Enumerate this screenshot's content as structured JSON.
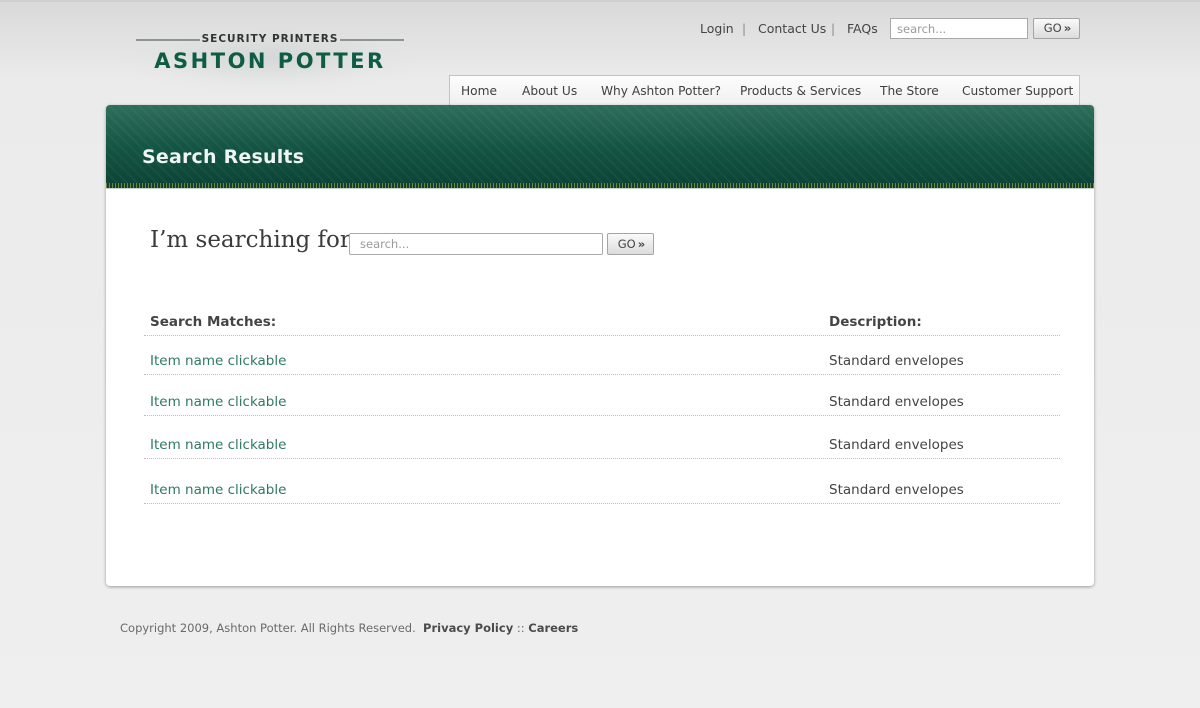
{
  "header": {
    "logo": {
      "tagline": "SECURITY PRINTERS",
      "name": "ASHTON POTTER"
    },
    "util_links": [
      "Login",
      "Contact Us",
      "FAQs"
    ],
    "search": {
      "placeholder": "search...",
      "go_label": "GO"
    }
  },
  "nav": [
    "Home",
    "About Us",
    "Why Ashton Potter?",
    "Products & Services",
    "The Store",
    "Customer Support"
  ],
  "main": {
    "title": "Search Results",
    "search_label": "I’m searching for:",
    "search_placeholder": "search...",
    "go_label": "GO",
    "table": {
      "headers": [
        "Search Matches:",
        "Description:"
      ],
      "rows": [
        {
          "name": "Item name clickable",
          "description": "Standard envelopes"
        },
        {
          "name": "Item name clickable",
          "description": "Standard envelopes"
        },
        {
          "name": "Item name clickable",
          "description": "Standard envelopes"
        },
        {
          "name": "Item name clickable",
          "description": "Standard envelopes"
        }
      ]
    }
  },
  "footer": {
    "copyright": "Copyright 2009, Ashton Potter. All Rights Reserved.",
    "links": [
      "Privacy Policy",
      "Careers"
    ],
    "separator": "::"
  },
  "colors": {
    "brand_green": "#0f5c44",
    "link_green": "#2f7a5e"
  }
}
